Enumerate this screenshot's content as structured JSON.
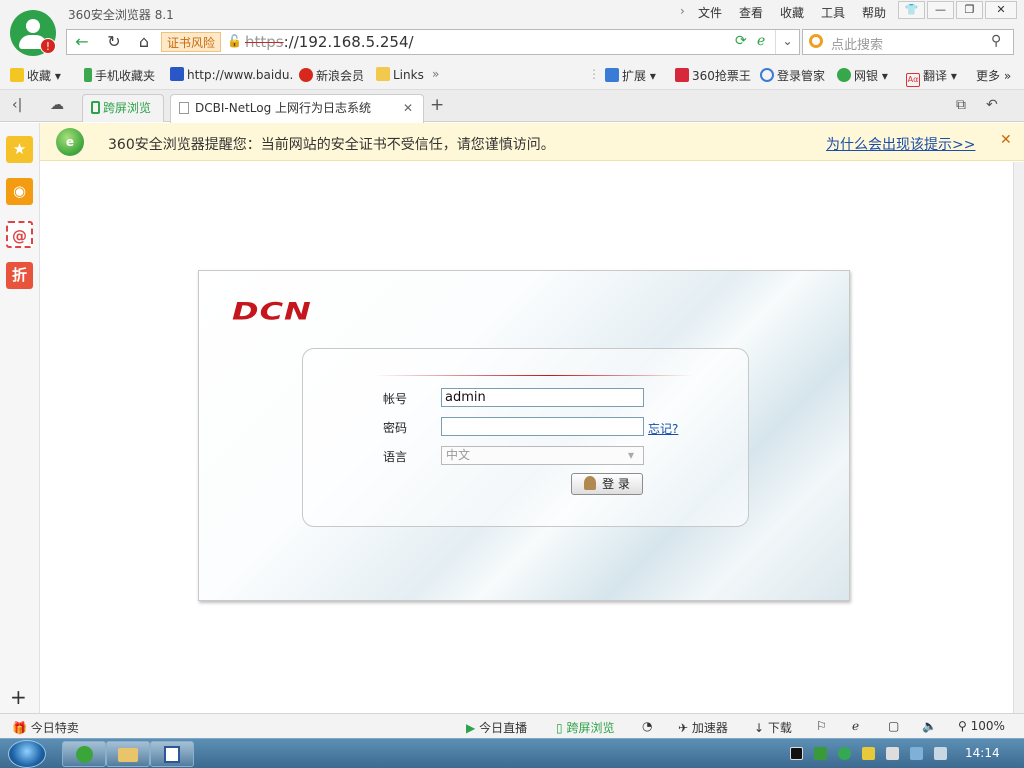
{
  "app": {
    "title": "360安全浏览器 8.1"
  },
  "menu": [
    "文件",
    "查看",
    "收藏",
    "工具",
    "帮助"
  ],
  "address": {
    "cert_warning": "证书风险",
    "protocol": "https",
    "rest": "://192.168.5.254/"
  },
  "search": {
    "placeholder": "点此搜索"
  },
  "bookmarks": {
    "left": [
      "收藏",
      "手机收藏夹",
      "http://www.baidu.",
      "新浪会员",
      "Links"
    ],
    "right": [
      "扩展",
      "360抢票王",
      "登录管家",
      "网银",
      "翻译",
      "更多"
    ]
  },
  "tabs": {
    "pinned": "跨屏浏览",
    "active": "DCBI-NetLog 上网行为日志系统",
    "new_tab": "+"
  },
  "notice": {
    "message": "360安全浏览器提醒您：当前网站的安全证书不受信任，请您谨慎访问。",
    "link": "为什么会出现该提示>>"
  },
  "login": {
    "brand": "DCN",
    "account_label": "帐号",
    "account_value": "admin",
    "password_label": "密码",
    "password_value": "",
    "forgot": "忘记?",
    "language_label": "语言",
    "language_value": "中文",
    "submit": "登 录"
  },
  "statusbar": {
    "left": "今日特卖",
    "live": "今日直播",
    "cross_screen": "跨屏浏览",
    "accelerator": "加速器",
    "download": "下载",
    "zoom": "100%"
  },
  "taskbar": {
    "clock": "14:14"
  },
  "colors": {
    "accent_green": "#2ea24a",
    "brand_red": "#c4161c",
    "link_blue": "#1a4da8",
    "notice_bg": "#fff8d8"
  }
}
